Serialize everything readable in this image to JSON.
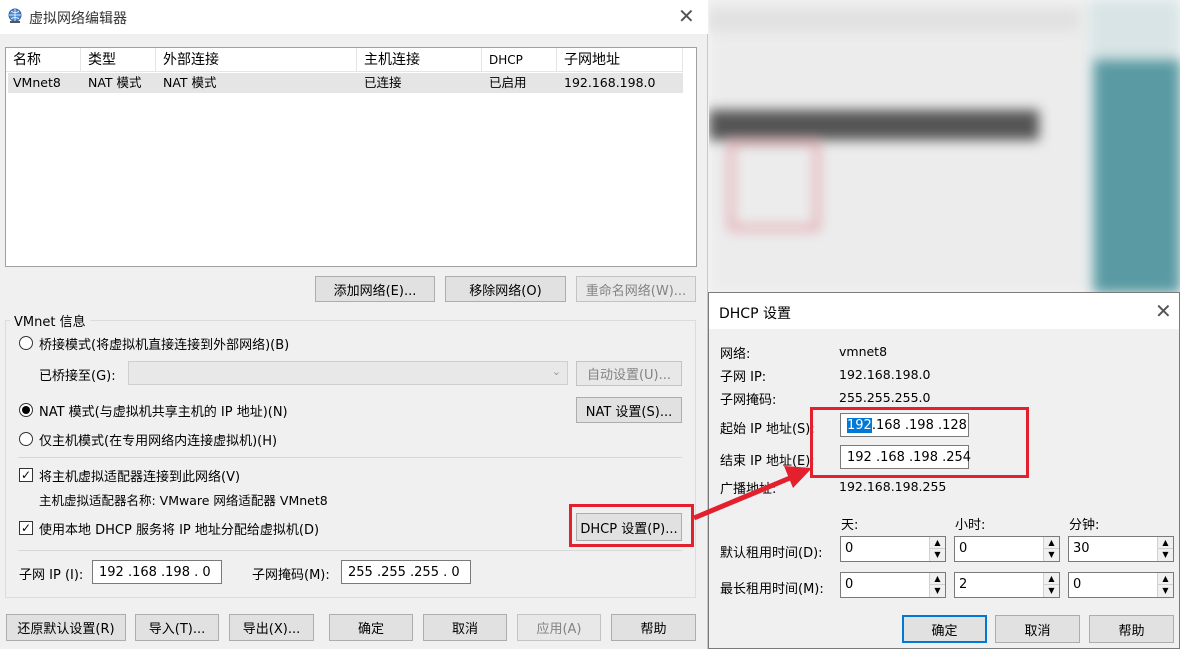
{
  "main_window": {
    "title": "虚拟网络编辑器",
    "columns": [
      "名称",
      "类型",
      "外部连接",
      "主机连接",
      "DHCP",
      "子网地址"
    ],
    "rows": [
      [
        "VMnet8",
        "NAT 模式",
        "NAT 模式",
        "已连接",
        "已启用",
        "192.168.198.0"
      ]
    ],
    "buttons": {
      "add_network": "添加网络(E)...",
      "remove_network": "移除网络(O)",
      "rename_network": "重命名网络(W)..."
    },
    "vmnet_info": {
      "group_label": "VMnet 信息",
      "bridge_mode": "桥接模式(将虚拟机直接连接到外部网络)(B)",
      "bridged_to_label": "已桥接至(G):",
      "auto_settings": "自动设置(U)...",
      "nat_mode": "NAT 模式(与虚拟机共享主机的 IP 地址)(N)",
      "nat_settings": "NAT 设置(S)...",
      "host_only_mode": "仅主机模式(在专用网络内连接虚拟机)(H)",
      "connect_adapter": "将主机虚拟适配器连接到此网络(V)",
      "adapter_name": "主机虚拟适配器名称: VMware 网络适配器 VMnet8",
      "use_dhcp": "使用本地 DHCP 服务将 IP 地址分配给虚拟机(D)",
      "dhcp_settings": "DHCP 设置(P)...",
      "subnet_ip_label": "子网 IP (I):",
      "subnet_ip_value": "192 .168 .198 . 0",
      "subnet_mask_label": "子网掩码(M):",
      "subnet_mask_value": "255 .255 .255 . 0"
    },
    "footer_buttons": {
      "restore_defaults": "还原默认设置(R)",
      "import": "导入(T)...",
      "export": "导出(X)...",
      "ok": "确定",
      "cancel": "取消",
      "apply": "应用(A)",
      "help": "帮助"
    }
  },
  "dhcp_dialog": {
    "title": "DHCP 设置",
    "network_label": "网络:",
    "network_value": "vmnet8",
    "subnet_ip_label": "子网 IP:",
    "subnet_ip_value": "192.168.198.0",
    "subnet_mask_label": "子网掩码:",
    "subnet_mask_value": "255.255.255.0",
    "start_ip_label": "起始 IP 地址(S):",
    "start_ip_selected": "192",
    "start_ip_rest": ".168 .198 .128",
    "end_ip_label": "结束 IP 地址(E):",
    "end_ip_value": "192 .168 .198 .254",
    "broadcast_label": "广播地址:",
    "broadcast_value": "192.168.198.255",
    "col_days": "天:",
    "col_hours": "小时:",
    "col_minutes": "分钟:",
    "default_lease_label": "默认租用时间(D):",
    "default_lease": [
      "0",
      "0",
      "30"
    ],
    "max_lease_label": "最长租用时间(M):",
    "max_lease": [
      "0",
      "2",
      "0"
    ],
    "buttons": {
      "ok": "确定",
      "cancel": "取消",
      "help": "帮助"
    }
  },
  "colors": {
    "highlight": "#e3202d",
    "accent": "#0078d7"
  }
}
